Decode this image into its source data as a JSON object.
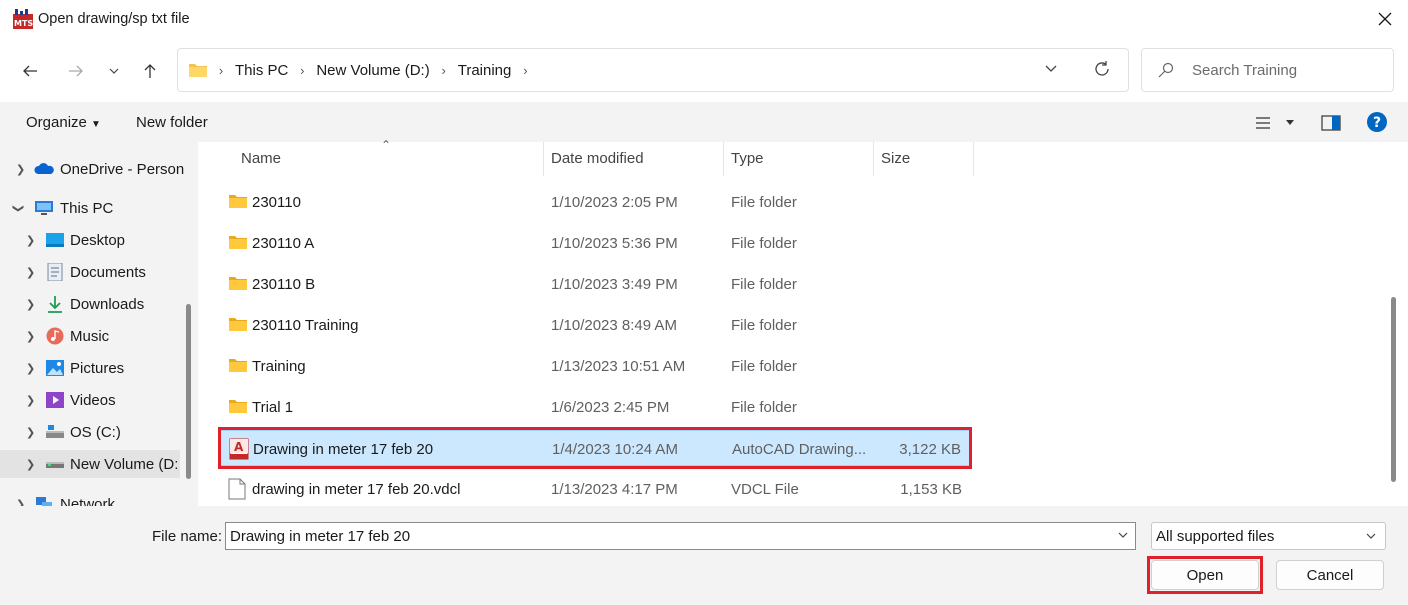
{
  "window": {
    "title": "Open drawing/sp txt file"
  },
  "address": {
    "crumbs": [
      "This PC",
      "New Volume (D:)",
      "Training"
    ]
  },
  "search": {
    "placeholder": "Search Training"
  },
  "toolbar": {
    "organize": "Organize",
    "new_folder": "New folder"
  },
  "sidebar": {
    "items": [
      {
        "label": "OneDrive - Person",
        "icon": "onedrive-icon"
      },
      {
        "label": "This PC",
        "icon": "pc-icon"
      },
      {
        "label": "Desktop",
        "icon": "desktop-icon"
      },
      {
        "label": "Documents",
        "icon": "documents-icon"
      },
      {
        "label": "Downloads",
        "icon": "downloads-icon"
      },
      {
        "label": "Music",
        "icon": "music-icon"
      },
      {
        "label": "Pictures",
        "icon": "pictures-icon"
      },
      {
        "label": "Videos",
        "icon": "videos-icon"
      },
      {
        "label": "OS (C:)",
        "icon": "drive-icon"
      },
      {
        "label": "New Volume (D:",
        "icon": "drive-icon"
      },
      {
        "label": "Network",
        "icon": "network-icon"
      }
    ]
  },
  "columns": {
    "name": "Name",
    "date": "Date modified",
    "type": "Type",
    "size": "Size"
  },
  "files": [
    {
      "name": "230110",
      "date": "1/10/2023 2:05 PM",
      "type": "File folder",
      "size": ""
    },
    {
      "name": "230110 A",
      "date": "1/10/2023 5:36 PM",
      "type": "File folder",
      "size": ""
    },
    {
      "name": "230110 B",
      "date": "1/10/2023 3:49 PM",
      "type": "File folder",
      "size": ""
    },
    {
      "name": "230110 Training",
      "date": "1/10/2023 8:49 AM",
      "type": "File folder",
      "size": ""
    },
    {
      "name": "Training",
      "date": "1/13/2023 10:51 AM",
      "type": "File folder",
      "size": ""
    },
    {
      "name": "Trial 1",
      "date": "1/6/2023 2:45 PM",
      "type": "File folder",
      "size": ""
    },
    {
      "name": "Drawing in meter 17 feb 20",
      "date": "1/4/2023 10:24 AM",
      "type": "AutoCAD Drawing...",
      "size": "3,122 KB"
    },
    {
      "name": "drawing in meter 17 feb 20.vdcl",
      "date": "1/13/2023 4:17 PM",
      "type": "VDCL File",
      "size": "1,153 KB"
    }
  ],
  "bottom": {
    "file_name_label": "File name:",
    "file_name_value": "Drawing in meter 17 feb 20",
    "filter_value": "All supported files",
    "open_label": "Open",
    "cancel_label": "Cancel"
  },
  "colors": {
    "accent": "#0067c0",
    "selected_row": "#cce8ff",
    "highlight_box": "#e0202a",
    "folder": "#f4c34d"
  }
}
